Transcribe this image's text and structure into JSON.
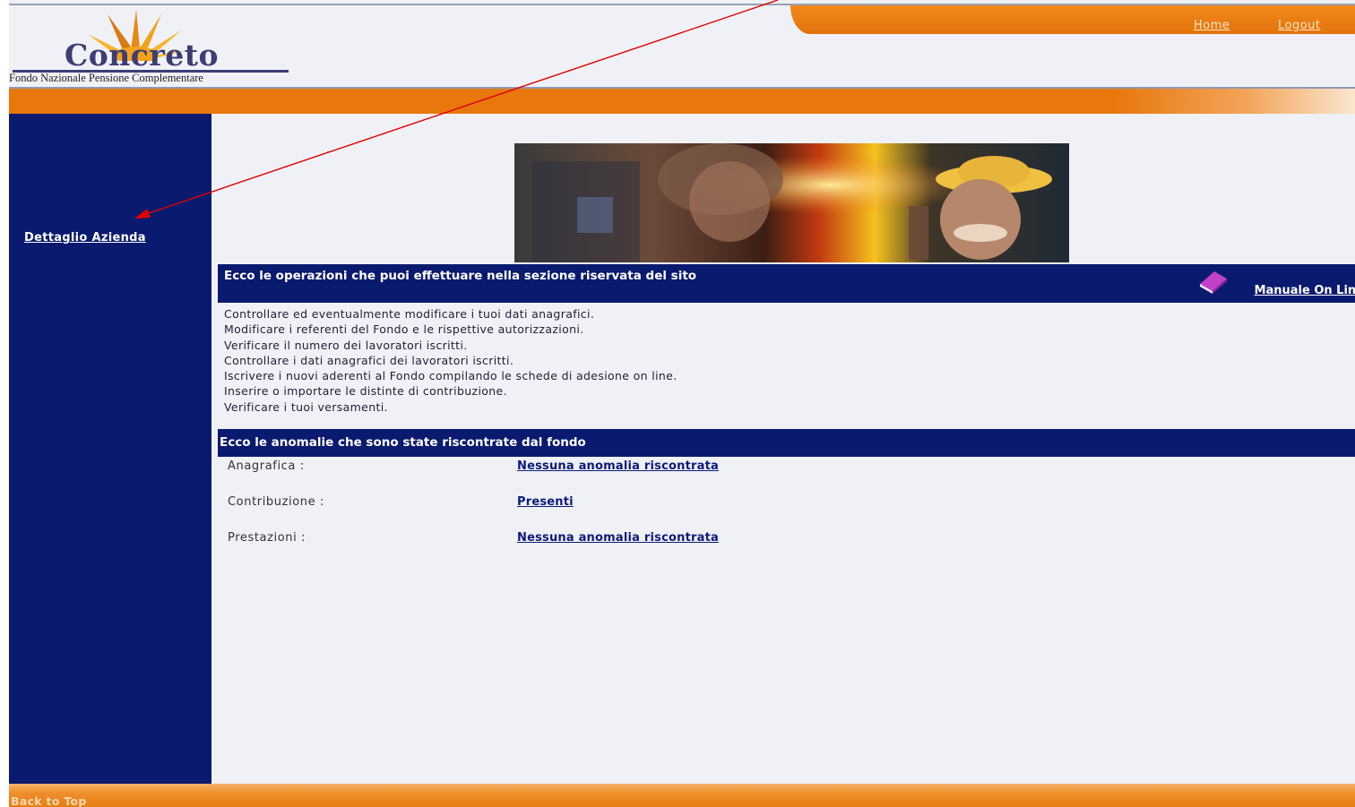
{
  "header": {
    "links": {
      "home": "Home",
      "logout": "Logout"
    },
    "logo": {
      "name": "Concreto",
      "tagline": "Fondo Nazionale Pensione Complementare"
    }
  },
  "sidebar": {
    "items": [
      {
        "label": "Dettaglio Azienda"
      }
    ]
  },
  "operations": {
    "title": "Ecco le operazioni che puoi effettuare nella sezione riservata del sito",
    "manual_link": "Manuale On Line",
    "items": [
      "Controllare ed eventualmente modificare i tuoi dati anagrafici.",
      "Modificare i referenti del Fondo e le rispettive autorizzazioni.",
      "Verificare il numero dei lavoratori iscritti.",
      "Controllare i dati anagrafici dei lavoratori iscritti.",
      "Iscrivere i nuovi aderenti al Fondo compilando le schede di adesione on line.",
      "Inserire o importare le distinte di contribuzione.",
      "Verificare i tuoi versamenti."
    ]
  },
  "anomalies": {
    "title": "Ecco le anomalie che sono state riscontrate dal fondo",
    "rows": [
      {
        "label": "Anagrafica :",
        "value": "Nessuna anomalia riscontrata"
      },
      {
        "label": "Contribuzione :",
        "value": "Presenti"
      },
      {
        "label": "Prestazioni :",
        "value": "Nessuna anomalia riscontrata"
      }
    ]
  },
  "footer": {
    "back_to_top": "Back to Top"
  },
  "colors": {
    "navy": "#0a1a6e",
    "orange": "#e8770c",
    "page_bg": "#f0f1f6",
    "annotation_arrow": "#e00000"
  },
  "icons": {
    "manual": "book-icon",
    "logo_sun": "sun-icon",
    "annotation": "arrow-icon"
  }
}
